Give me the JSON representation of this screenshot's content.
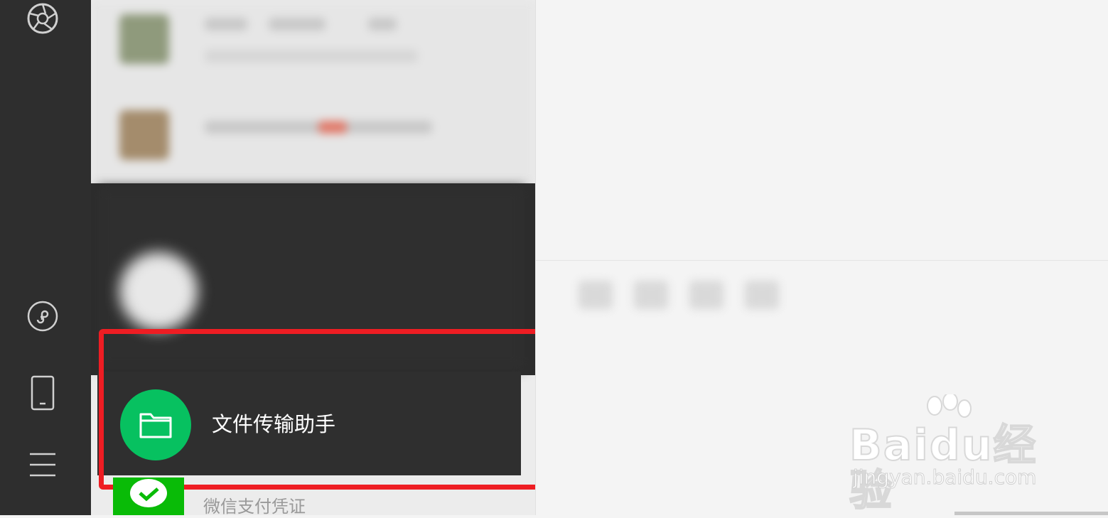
{
  "window": {
    "background": "#f4f4f4",
    "accent": "#07c160",
    "annotation_color": "#ee1d23"
  },
  "nav_rail": {
    "icons": [
      "moments-icon",
      "mini-program-icon",
      "phone-icon",
      "menu-icon"
    ]
  },
  "chat_list": {
    "selected_item": {
      "name": "文件传输助手",
      "icon": "folder-icon"
    },
    "next_item": {
      "name": "微信支付凭证",
      "icon": "wechat-pay-icon"
    }
  },
  "watermark": {
    "brand": "Baidu经验",
    "url": "jingyan.baidu.com"
  }
}
